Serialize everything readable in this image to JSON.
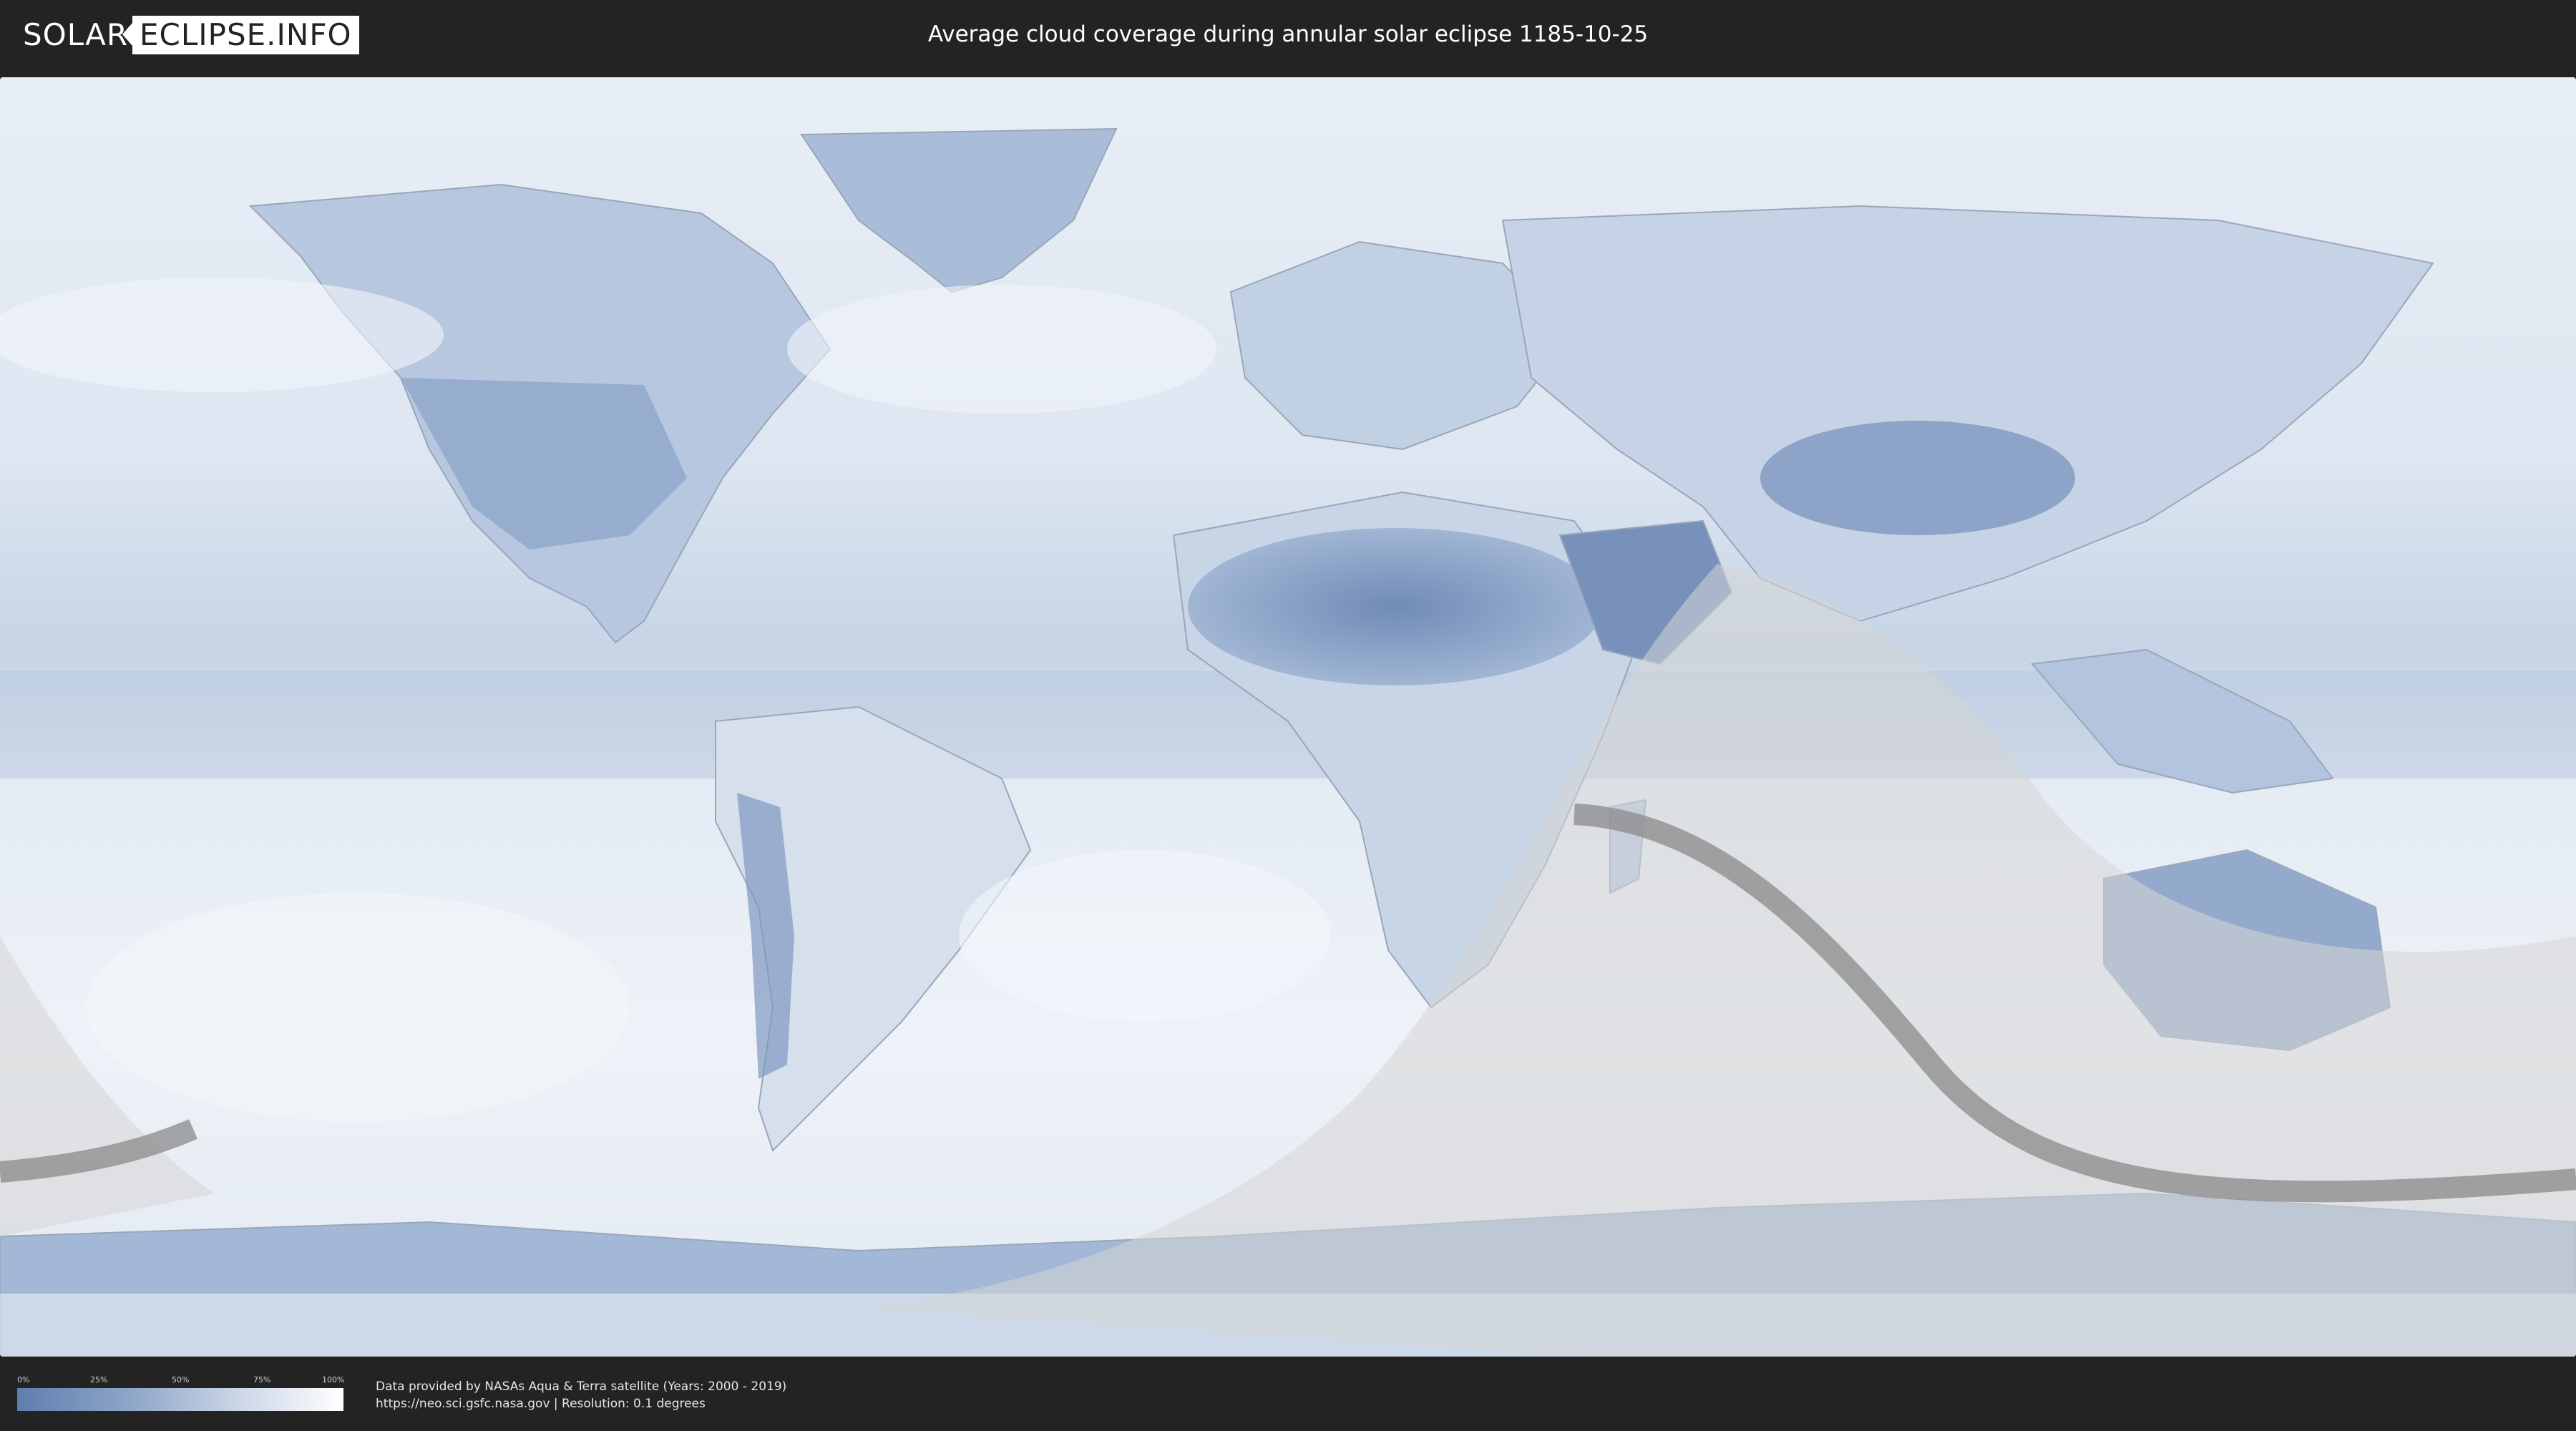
{
  "header": {
    "logo_part1": "SOLAR",
    "logo_part2": "ECLIPSE.INFO",
    "title": "Average cloud coverage during annular solar eclipse 1185-10-25"
  },
  "map": {
    "ocean_color": "#dfe7f1",
    "land_color": "#c9d6e7",
    "dry_region_color": "#6f8ab6",
    "night_shadow_color": "#d9d9d9",
    "path_color": "#8a8a8a"
  },
  "legend": {
    "ticks": [
      "0%",
      "25%",
      "50%",
      "75%",
      "100%"
    ],
    "low_color": "#5f7eaf",
    "high_color": "#ffffff"
  },
  "footer": {
    "credit_line1": "Data provided by NASAs Aqua & Terra satellite (Years: 2000 - 2019)",
    "credit_line2": "https://neo.sci.gsfc.nasa.gov | Resolution: 0.1 degrees"
  }
}
